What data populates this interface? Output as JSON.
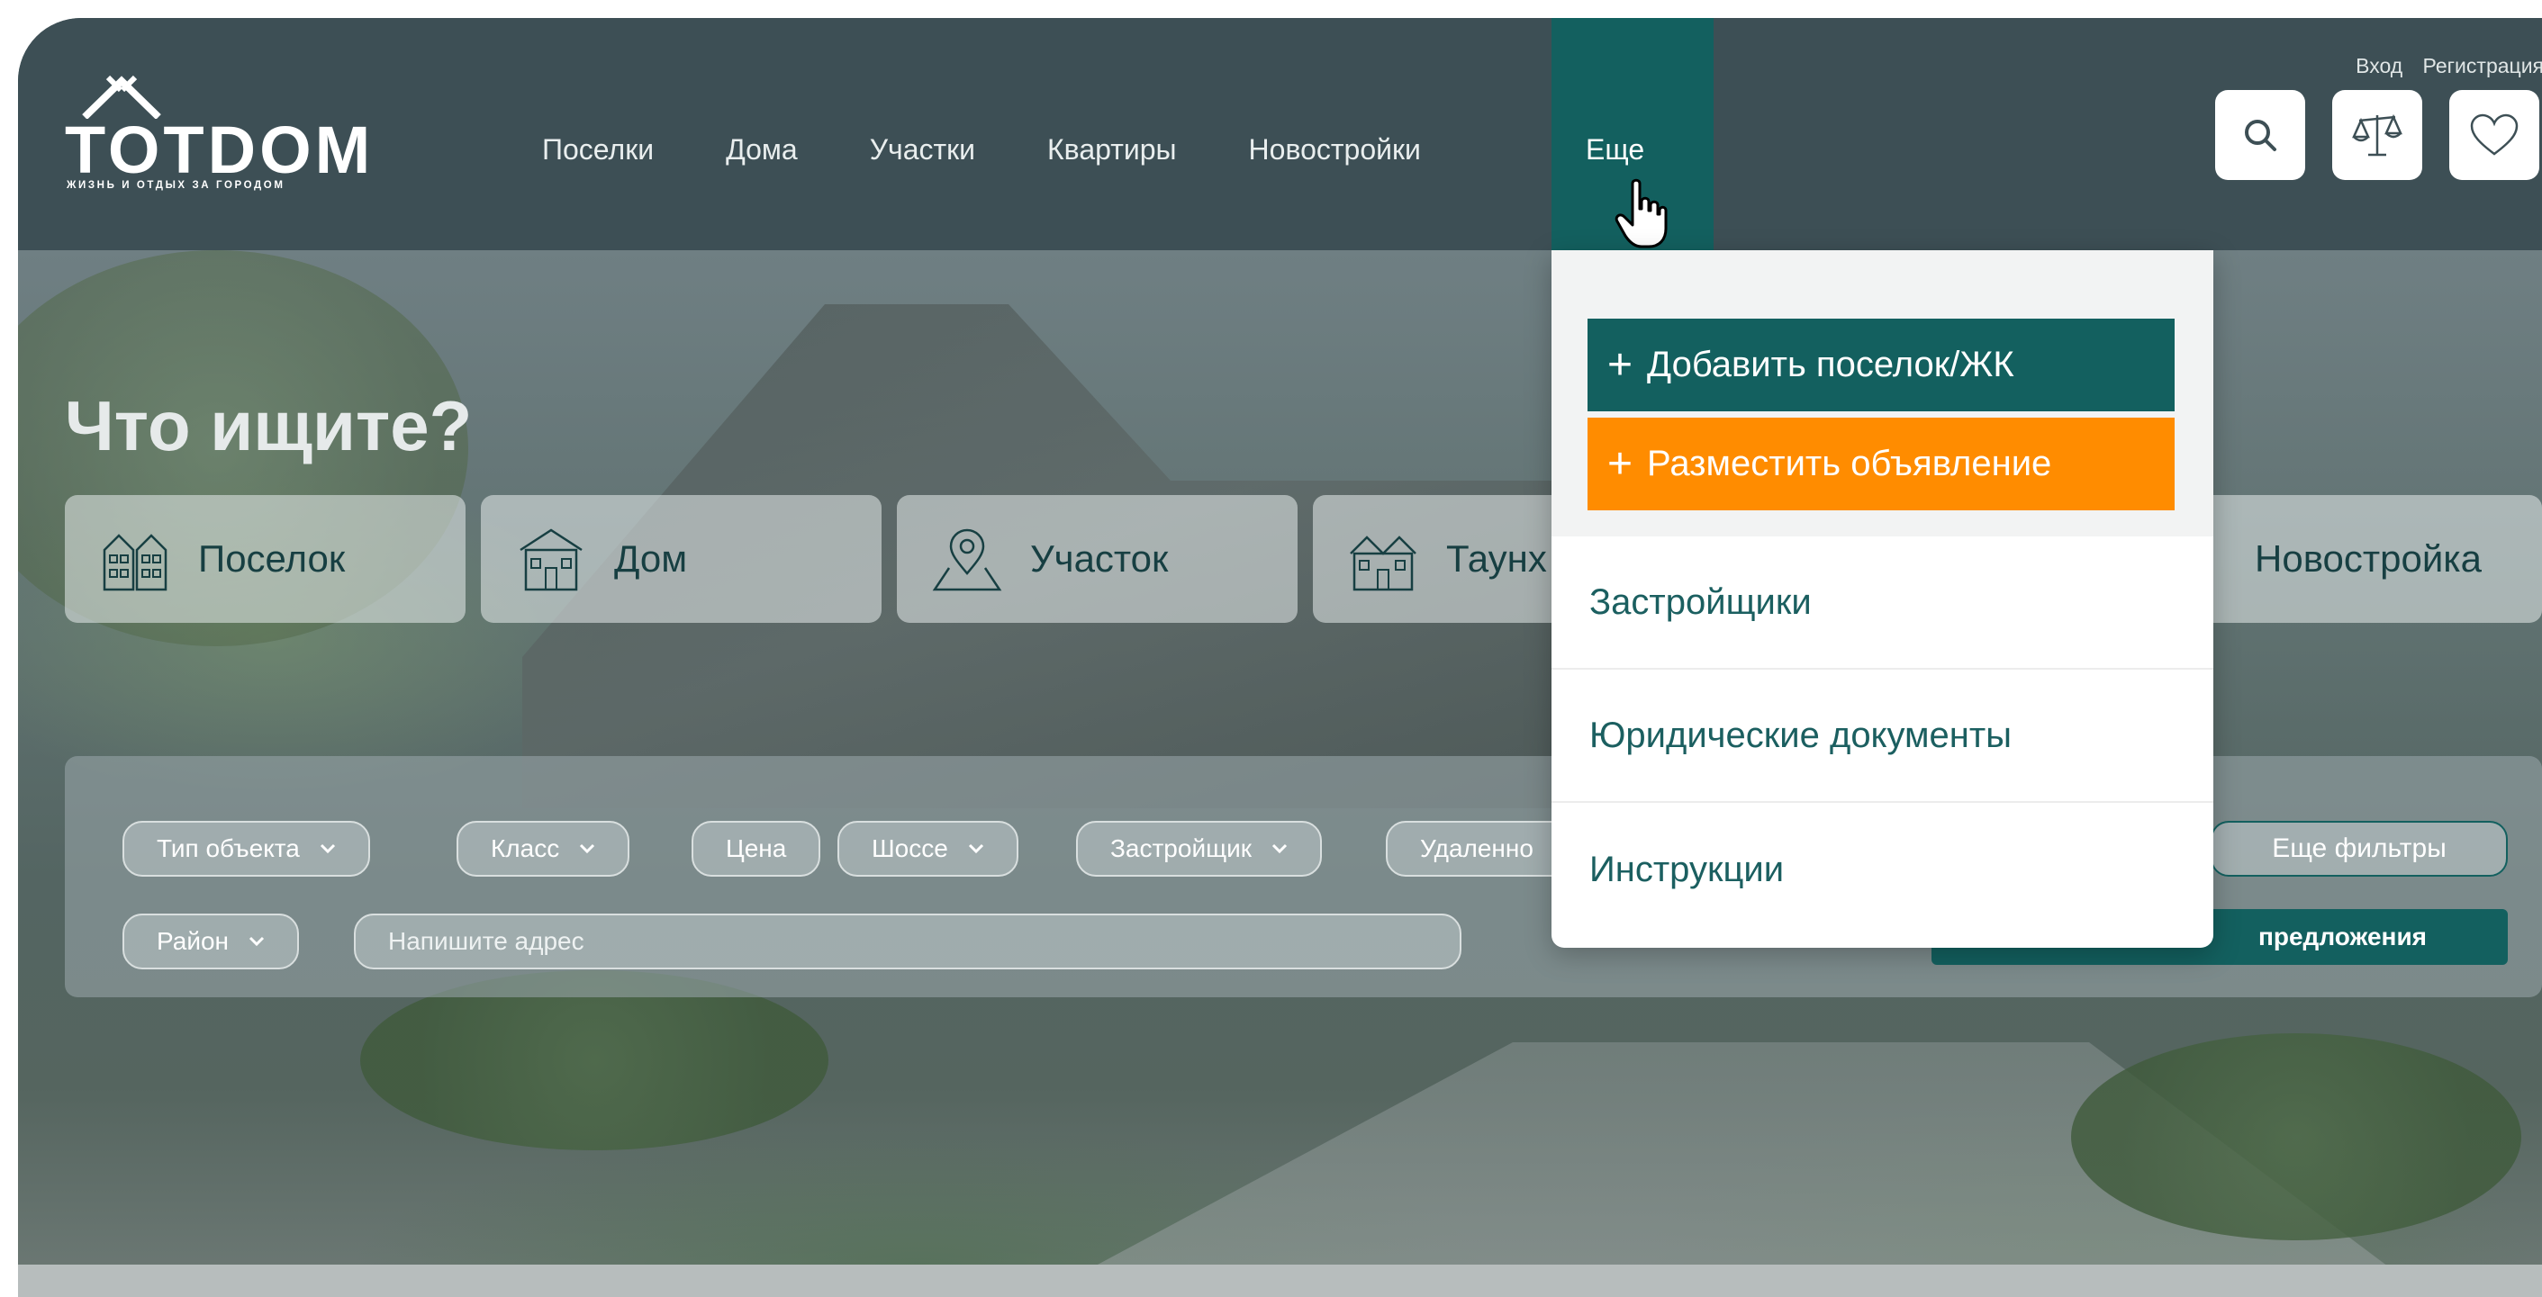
{
  "brand": {
    "name": "TOTDOM",
    "tagline": "ЖИЗНЬ И ОТДЫХ ЗА ГОРОДОМ"
  },
  "nav": {
    "items": [
      "Поселки",
      "Дома",
      "Участки",
      "Квартиры",
      "Новостройки"
    ],
    "more_label": "Еще"
  },
  "auth": {
    "login": "Вход",
    "register": "Регистрация"
  },
  "icons": {
    "search": "search-icon",
    "compare": "scales-icon",
    "favorites": "heart-icon"
  },
  "hero": {
    "title": "Что ищите?"
  },
  "categories": [
    {
      "label": "Поселок",
      "icon": "village-icon"
    },
    {
      "label": "Дом",
      "icon": "house-icon"
    },
    {
      "label": "Участок",
      "icon": "location-pin-icon"
    },
    {
      "label": "Таунх",
      "icon": "townhouse-icon"
    },
    {
      "label": "Новостройка",
      "icon": "building-icon"
    }
  ],
  "filters": {
    "pills": [
      "Тип объекта",
      "Класс",
      "Цена",
      "Шоссе",
      "Застройщик",
      "Удаленно"
    ],
    "district": "Район",
    "address_placeholder": "Напишите адрес",
    "more_filters": "Еще фильтры",
    "show_button": "предложения"
  },
  "dropdown": {
    "add_village": "Добавить поселок/ЖК",
    "post_listing": "Разместить объявление",
    "items": [
      "Застройщики",
      "Юридические документы",
      "Инструкции"
    ]
  },
  "colors": {
    "nav_bg": "#3d4f55",
    "accent_teal": "#13605f",
    "accent_orange": "#ff8c00",
    "dropdown_text": "#1b5f60"
  }
}
